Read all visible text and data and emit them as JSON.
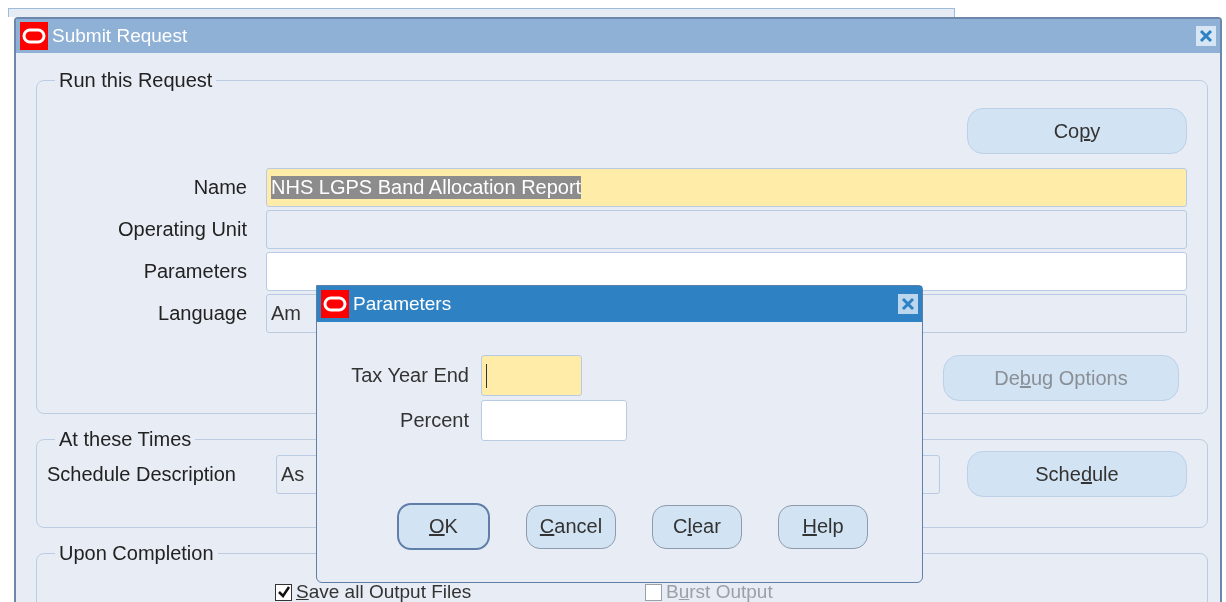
{
  "window": {
    "title": "Submit Request"
  },
  "run_section": {
    "title": "Run this Request",
    "copy_button": {
      "parts": {
        "before": "Co",
        "key": "p",
        "after": "y"
      },
      "disabled": false
    },
    "fields": [
      {
        "label": "Name",
        "value": "NHS LGPS Band Allocation Report",
        "kind": "selected"
      },
      {
        "label": "Operating Unit",
        "kind": "readonly"
      },
      {
        "label": "Parameters",
        "kind": "editable"
      },
      {
        "label": "Language",
        "value": "Am",
        "kind": "readonly"
      }
    ],
    "debug_button": {
      "parts": {
        "before": "De",
        "key": "b",
        "after": "ug Options"
      },
      "disabled": true
    }
  },
  "times_section": {
    "title": "At these Times",
    "label": "Schedule Description",
    "value": "As",
    "schedule_button": {
      "parts": {
        "before": "Sche",
        "key": "d",
        "after": "ule"
      },
      "disabled": false
    }
  },
  "completion_section": {
    "title": "Upon Completion",
    "options": [
      {
        "parts": {
          "key": "S",
          "after": "ave all Output Files"
        },
        "checked": true,
        "disabled": false
      },
      {
        "parts": {
          "before": "B",
          "key": "u",
          "after": "rst Output"
        },
        "checked": false,
        "disabled": true
      }
    ]
  },
  "dialog": {
    "title": "Parameters",
    "fields": [
      {
        "label": "Tax Year End",
        "focused": true
      },
      {
        "label": "Percent",
        "focused": false
      }
    ],
    "buttons": [
      {
        "parts": {
          "key": "O",
          "after": "K"
        },
        "default": true
      },
      {
        "parts": {
          "key": "C",
          "after": "ancel"
        },
        "default": false
      },
      {
        "parts": {
          "before": "C",
          "key": "l",
          "after": "ear"
        },
        "default": false
      },
      {
        "parts": {
          "key": "H",
          "after": "elp"
        },
        "default": false
      }
    ]
  }
}
